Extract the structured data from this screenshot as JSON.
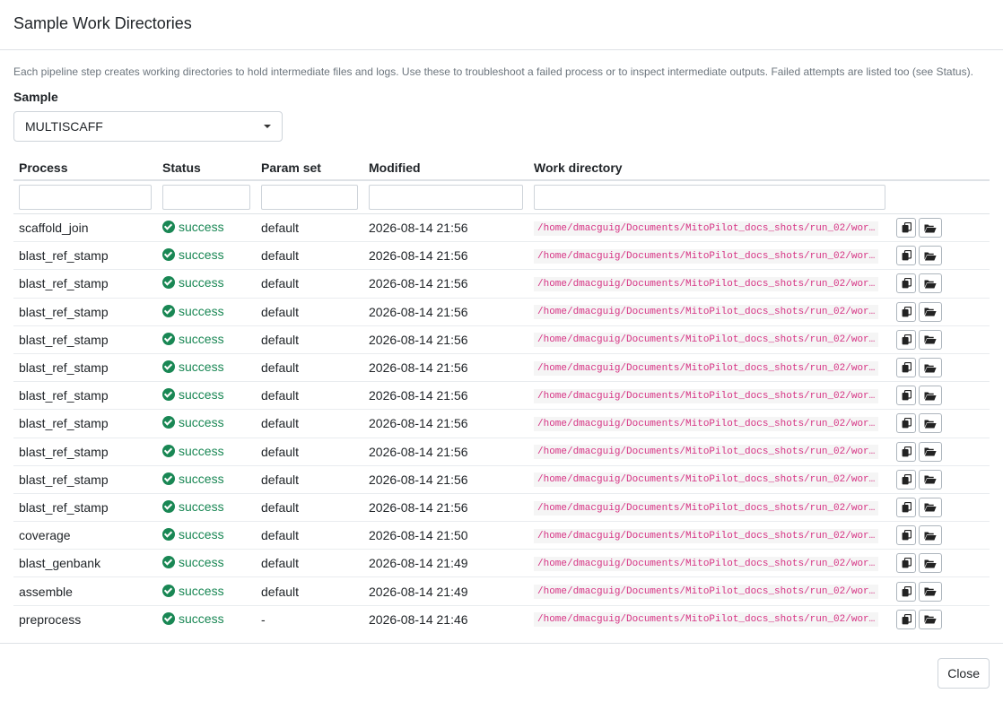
{
  "modal": {
    "title": "Sample Work Directories",
    "help_text": "Each pipeline step creates working directories to hold intermediate files and logs. Use these to troubleshoot a failed process or to inspect intermediate outputs. Failed attempts are listed too (see Status).",
    "sample_label": "Sample",
    "sample_value": "MULTISCAFF",
    "close_label": "Close"
  },
  "table": {
    "headers": {
      "process": "Process",
      "status": "Status",
      "param_set": "Param set",
      "modified": "Modified",
      "work_directory": "Work directory"
    },
    "rows": [
      {
        "process": "scaffold_join",
        "status": "success",
        "param_set": "default",
        "modified": "2026-08-14 21:56",
        "path": "/home/dmacguig/Documents/MitoPilot_docs_shots/run_02/wor…"
      },
      {
        "process": "blast_ref_stamp",
        "status": "success",
        "param_set": "default",
        "modified": "2026-08-14 21:56",
        "path": "/home/dmacguig/Documents/MitoPilot_docs_shots/run_02/wor…"
      },
      {
        "process": "blast_ref_stamp",
        "status": "success",
        "param_set": "default",
        "modified": "2026-08-14 21:56",
        "path": "/home/dmacguig/Documents/MitoPilot_docs_shots/run_02/wor…"
      },
      {
        "process": "blast_ref_stamp",
        "status": "success",
        "param_set": "default",
        "modified": "2026-08-14 21:56",
        "path": "/home/dmacguig/Documents/MitoPilot_docs_shots/run_02/wor…"
      },
      {
        "process": "blast_ref_stamp",
        "status": "success",
        "param_set": "default",
        "modified": "2026-08-14 21:56",
        "path": "/home/dmacguig/Documents/MitoPilot_docs_shots/run_02/wor…"
      },
      {
        "process": "blast_ref_stamp",
        "status": "success",
        "param_set": "default",
        "modified": "2026-08-14 21:56",
        "path": "/home/dmacguig/Documents/MitoPilot_docs_shots/run_02/wor…"
      },
      {
        "process": "blast_ref_stamp",
        "status": "success",
        "param_set": "default",
        "modified": "2026-08-14 21:56",
        "path": "/home/dmacguig/Documents/MitoPilot_docs_shots/run_02/wor…"
      },
      {
        "process": "blast_ref_stamp",
        "status": "success",
        "param_set": "default",
        "modified": "2026-08-14 21:56",
        "path": "/home/dmacguig/Documents/MitoPilot_docs_shots/run_02/wor…"
      },
      {
        "process": "blast_ref_stamp",
        "status": "success",
        "param_set": "default",
        "modified": "2026-08-14 21:56",
        "path": "/home/dmacguig/Documents/MitoPilot_docs_shots/run_02/wor…"
      },
      {
        "process": "blast_ref_stamp",
        "status": "success",
        "param_set": "default",
        "modified": "2026-08-14 21:56",
        "path": "/home/dmacguig/Documents/MitoPilot_docs_shots/run_02/wor…"
      },
      {
        "process": "blast_ref_stamp",
        "status": "success",
        "param_set": "default",
        "modified": "2026-08-14 21:56",
        "path": "/home/dmacguig/Documents/MitoPilot_docs_shots/run_02/wor…"
      },
      {
        "process": "coverage",
        "status": "success",
        "param_set": "default",
        "modified": "2026-08-14 21:50",
        "path": "/home/dmacguig/Documents/MitoPilot_docs_shots/run_02/wor…"
      },
      {
        "process": "blast_genbank",
        "status": "success",
        "param_set": "default",
        "modified": "2026-08-14 21:49",
        "path": "/home/dmacguig/Documents/MitoPilot_docs_shots/run_02/wor…"
      },
      {
        "process": "assemble",
        "status": "success",
        "param_set": "default",
        "modified": "2026-08-14 21:49",
        "path": "/home/dmacguig/Documents/MitoPilot_docs_shots/run_02/wor…"
      },
      {
        "process": "preprocess",
        "status": "success",
        "param_set": "-",
        "modified": "2026-08-14 21:46",
        "path": "/home/dmacguig/Documents/MitoPilot_docs_shots/run_02/wor…"
      }
    ]
  },
  "icons": {
    "status": "check-circle-icon",
    "copy": "copy-icon",
    "folder": "folder-open-icon",
    "select": "chevron-down-icon"
  },
  "colors": {
    "success": "#198754",
    "path_text": "#d63384"
  }
}
